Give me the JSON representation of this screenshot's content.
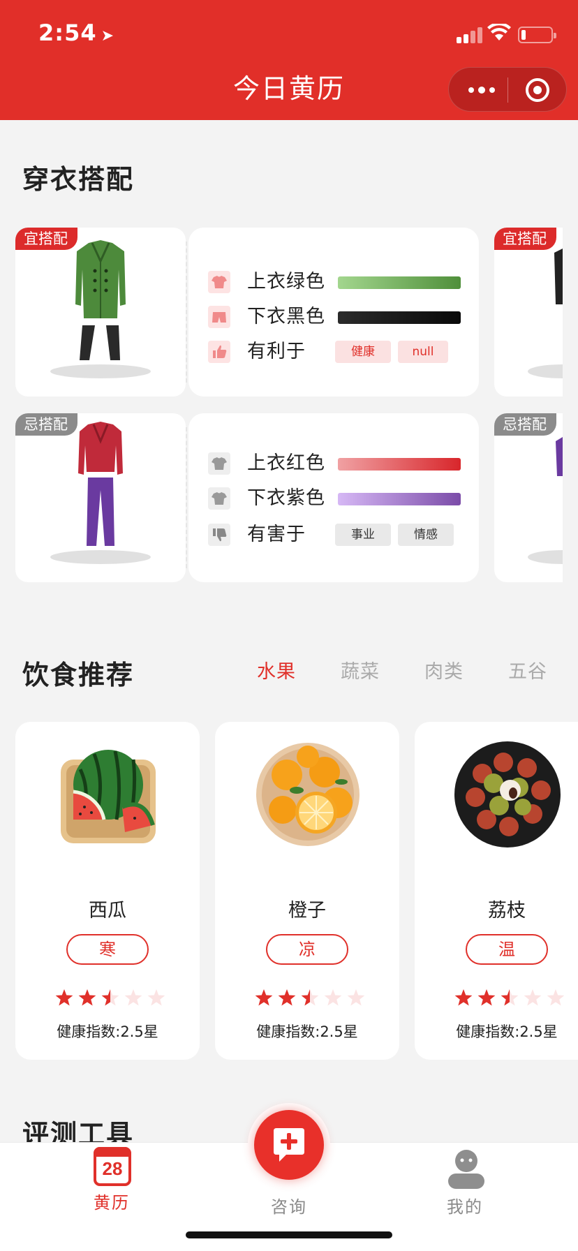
{
  "status_bar": {
    "time": "2:54",
    "location_icon": "location-arrow-icon"
  },
  "nav": {
    "title": "今日黄历"
  },
  "outfit": {
    "title": "穿衣搭配",
    "good": {
      "tag": "宜搭配",
      "top_label": "上衣绿色",
      "bottom_label": "下衣黑色",
      "benefit_label": "有利于",
      "benefits": [
        "健康",
        "null"
      ],
      "top_colors": [
        "#a3d68e",
        "#4f8f3a"
      ],
      "bottom_colors": [
        "#2b2b2b",
        "#0a0a0a"
      ]
    },
    "bad": {
      "tag": "忌搭配",
      "top_label": "上衣红色",
      "bottom_label": "下衣紫色",
      "harm_label": "有害于",
      "harms": [
        "事业",
        "情感"
      ],
      "top_colors": [
        "#f0a1a3",
        "#d8262b"
      ],
      "bottom_colors": [
        "#d6b8f5",
        "#7b4ca8"
      ]
    }
  },
  "diet": {
    "title": "饮食推荐",
    "tabs": [
      "水果",
      "蔬菜",
      "肉类",
      "五谷"
    ],
    "active_tab": "水果",
    "items": [
      {
        "name": "西瓜",
        "nature": "寒",
        "rating": 2.5,
        "health": "健康指数:2.5星",
        "icon": "watermelon-image"
      },
      {
        "name": "橙子",
        "nature": "凉",
        "rating": 2.5,
        "health": "健康指数:2.5星",
        "icon": "orange-image"
      },
      {
        "name": "荔枝",
        "nature": "温",
        "rating": 2.5,
        "health": "健康指数:2.5星",
        "icon": "lychee-image"
      }
    ]
  },
  "tools": {
    "title": "评测工具"
  },
  "tabbar": {
    "items": [
      {
        "label": "黄历",
        "icon": "calendar-icon",
        "calendar_day": "28"
      },
      {
        "label": "咨询",
        "icon": "chat-plus-icon"
      },
      {
        "label": "我的",
        "icon": "person-icon"
      }
    ],
    "active": "黄历"
  },
  "colors": {
    "brand_red": "#e12f29",
    "background": "#f3f3f3",
    "inactive_gray": "#8a8a8a"
  }
}
